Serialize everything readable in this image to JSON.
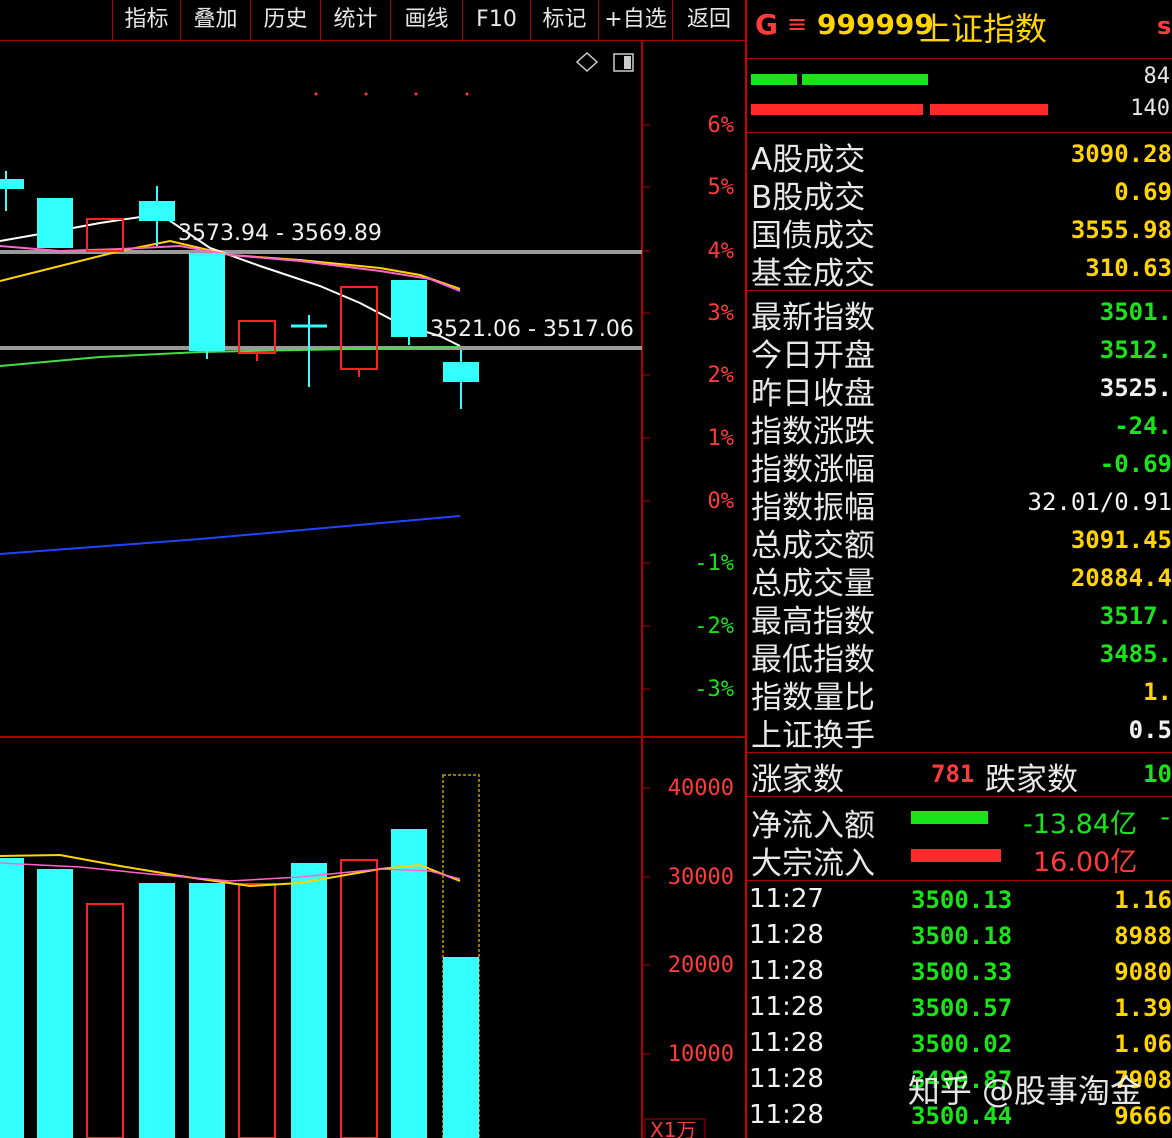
{
  "toolbar": {
    "buttons": [
      "指标",
      "叠加",
      "历史",
      "统计",
      "画线",
      "F10",
      "标记",
      "+自选",
      "返回"
    ]
  },
  "chart": {
    "annotations": [
      "3573.94 - 3569.89",
      "3521.06 - 3517.06"
    ],
    "pct_axis": [
      "6%",
      "5%",
      "4%",
      "3%",
      "2%",
      "1%",
      "0%",
      "-1%",
      "-2%",
      "-3%"
    ],
    "volume_axis": [
      "40000",
      "30000",
      "20000",
      "10000"
    ],
    "volume_unit": "X1万",
    "colors": {
      "up": "#ff2020",
      "down": "#33ffff",
      "ma_white": "#ffffff",
      "ma_yellow": "#ffd400",
      "ma_pink": "#ff66cc",
      "ma_green": "#44dd44",
      "ma_blue": "#2244ff"
    }
  },
  "header": {
    "market_letter": "G",
    "menu_icon": "menu-icon",
    "code": "999999",
    "name": "上证指数",
    "extra": "s"
  },
  "bars": {
    "green_count": "84",
    "red_count": "140"
  },
  "stats": [
    {
      "label": "A股成交",
      "value": "3090.28",
      "color": "yellow"
    },
    {
      "label": "B股成交",
      "value": "0.69",
      "color": "yellow"
    },
    {
      "label": "国债成交",
      "value": "3555.98",
      "color": "yellow"
    },
    {
      "label": "基金成交",
      "value": "310.63",
      "color": "yellow"
    }
  ],
  "quote": [
    {
      "label": "最新指数",
      "value": "3501.",
      "color": "green"
    },
    {
      "label": "今日开盘",
      "value": "3512.",
      "color": "green"
    },
    {
      "label": "昨日收盘",
      "value": "3525.",
      "color": "white"
    },
    {
      "label": "指数涨跌",
      "value": "-24.",
      "color": "green"
    },
    {
      "label": "指数涨幅",
      "value": "-0.69",
      "color": "green"
    },
    {
      "label": "指数振幅",
      "value": "32.01/0.91",
      "color": "white"
    },
    {
      "label": "总成交额",
      "value": "3091.45",
      "color": "yellow"
    },
    {
      "label": "总成交量",
      "value": "20884.4",
      "color": "yellow"
    },
    {
      "label": "最高指数",
      "value": "3517.",
      "color": "green"
    },
    {
      "label": "最低指数",
      "value": "3485.",
      "color": "green"
    },
    {
      "label": "指数量比",
      "value": "1.",
      "color": "yellow"
    },
    {
      "label": "上证换手",
      "value": "0.5",
      "color": "white"
    }
  ],
  "breadth": {
    "up_label": "涨家数",
    "up_value": "781",
    "down_label": "跌家数",
    "down_value": "10"
  },
  "flow": [
    {
      "label": "净流入额",
      "value": "-13.84亿",
      "extra": "-",
      "bar_color": "#19e319",
      "value_color": "green"
    },
    {
      "label": "大宗流入",
      "value": "16.00亿",
      "extra": "",
      "bar_color": "#ff2a2a",
      "value_color": "red"
    }
  ],
  "ticks": [
    {
      "time": "11:27",
      "price": "3500.13",
      "vol": "1.16"
    },
    {
      "time": "11:28",
      "price": "3500.18",
      "vol": "8988"
    },
    {
      "time": "11:28",
      "price": "3500.33",
      "vol": "9080"
    },
    {
      "time": "11:28",
      "price": "3500.57",
      "vol": "1.39"
    },
    {
      "time": "11:28",
      "price": "3500.02",
      "vol": "1.06"
    },
    {
      "time": "11:28",
      "price": "3499.87",
      "vol": "7908"
    },
    {
      "time": "11:28",
      "price": "3500.44",
      "vol": "9666"
    }
  ],
  "watermark": "知乎 @股事淘金"
}
